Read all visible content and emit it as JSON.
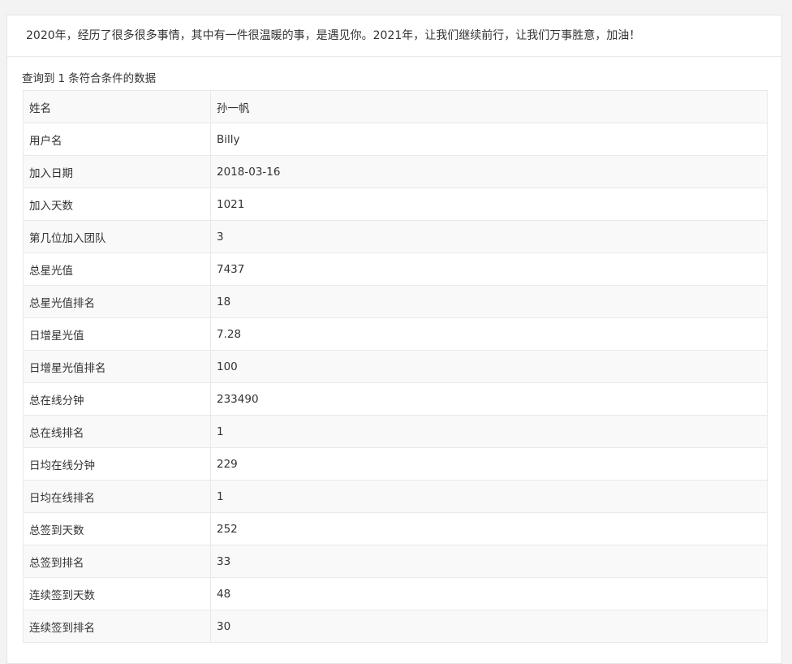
{
  "header": {
    "message": "2020年，经历了很多很多事情，其中有一件很温暖的事，是遇见你。2021年，让我们继续前行，让我们万事胜意，加油！"
  },
  "result": {
    "prefix": "查询到",
    "count": "1",
    "suffix": "条符合条件的数据"
  },
  "rows": [
    {
      "label": "姓名",
      "value": "孙一帆"
    },
    {
      "label": "用户名",
      "value": "Billy"
    },
    {
      "label": "加入日期",
      "value": "2018-03-16"
    },
    {
      "label": "加入天数",
      "value": "1021"
    },
    {
      "label": "第几位加入团队",
      "value": "3"
    },
    {
      "label": "总星光值",
      "value": "7437"
    },
    {
      "label": "总星光值排名",
      "value": "18"
    },
    {
      "label": "日增星光值",
      "value": "7.28"
    },
    {
      "label": "日增星光值排名",
      "value": "100"
    },
    {
      "label": "总在线分钟",
      "value": "233490"
    },
    {
      "label": "总在线排名",
      "value": "1"
    },
    {
      "label": "日均在线分钟",
      "value": "229"
    },
    {
      "label": "日均在线排名",
      "value": "1"
    },
    {
      "label": "总签到天数",
      "value": "252"
    },
    {
      "label": "总签到排名",
      "value": "33"
    },
    {
      "label": "连续签到天数",
      "value": "48"
    },
    {
      "label": "连续签到排名",
      "value": "30"
    }
  ]
}
